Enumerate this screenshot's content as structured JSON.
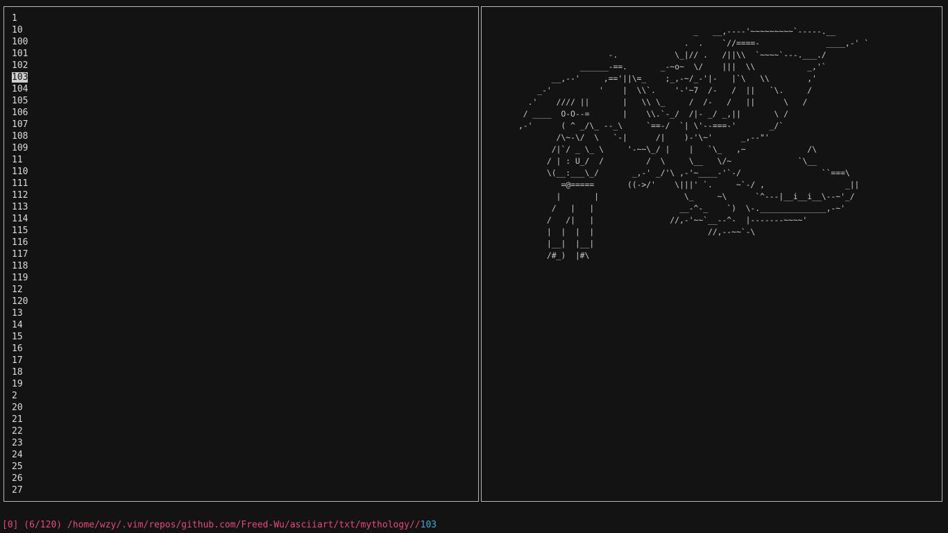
{
  "file_list": {
    "selected_index": 5,
    "items": [
      "1",
      "10",
      "100",
      "101",
      "102",
      "103",
      "104",
      "105",
      "106",
      "107",
      "108",
      "109",
      "11",
      "110",
      "111",
      "112",
      "113",
      "114",
      "115",
      "116",
      "117",
      "118",
      "119",
      "12",
      "120",
      "13",
      "14",
      "15",
      "16",
      "17",
      "18",
      "19",
      "2",
      "20",
      "21",
      "22",
      "23",
      "24",
      "25",
      "26",
      "27"
    ]
  },
  "preview": {
    "ascii_lines": [
      "                                           _   __,----'~~~~~~~~~`-----.__",
      "                                         .  .    `//====-              ____,-' `",
      "                         -.            \\_|// .   /||\\\\  `~~~~`---.___./",
      "                   ______-==.       _-~o~  \\/    |||  \\\\           _,'`",
      "             __,--'     ,=='||\\=_    ;_,-~/_-'|-   |`\\   \\\\        ,'",
      "          _-'          '    |  \\\\`.    '-'~7  /-   /  ||   `\\.     /",
      "        .'    //// ||       |   \\\\ \\_     /  /-   /   ||      \\   /",
      "       / ____  O-O--=       |    \\\\.`-_/  /|- _/ _,||       \\ /",
      "      ,-'      ( ^ _/\\_ --_\\     `==-/  `| \\'--===-'       _/`",
      "              /\\~-\\/  \\   `-|      /|    )-'\\~'      _,--\"'",
      "             /|`/ _ \\_ \\     '-~~\\_/ |    |   `\\_   ,~             /\\",
      "            / | : U_/  /         /  \\     \\__   \\/~              `\\__",
      "            \\(__:___\\_/       _,-' _/'\\ ,-'~____-'`-/                 ``===\\",
      "               =@=====       ((->/'    \\|||' `.     ~`-/ ,                 _||",
      "              |       |                  \\_     ~\\      `^---|__i__i__\\--~'_/",
      "             /   |   |                  __-^-_    `)  \\-.______________,-~'",
      "            /   /|   |                //,-'~~`__--^-  |-------~~~~'",
      "            |  |  |  |                        //,--~~`-\\",
      "            |__|  |__|",
      "            /#_)  |#\\"
    ]
  },
  "status": {
    "info": "[0] (6/120) /home/wzy/.vim/repos/github.com/Freed-Wu/asciiart/txt/mythology//",
    "selection": "103"
  }
}
